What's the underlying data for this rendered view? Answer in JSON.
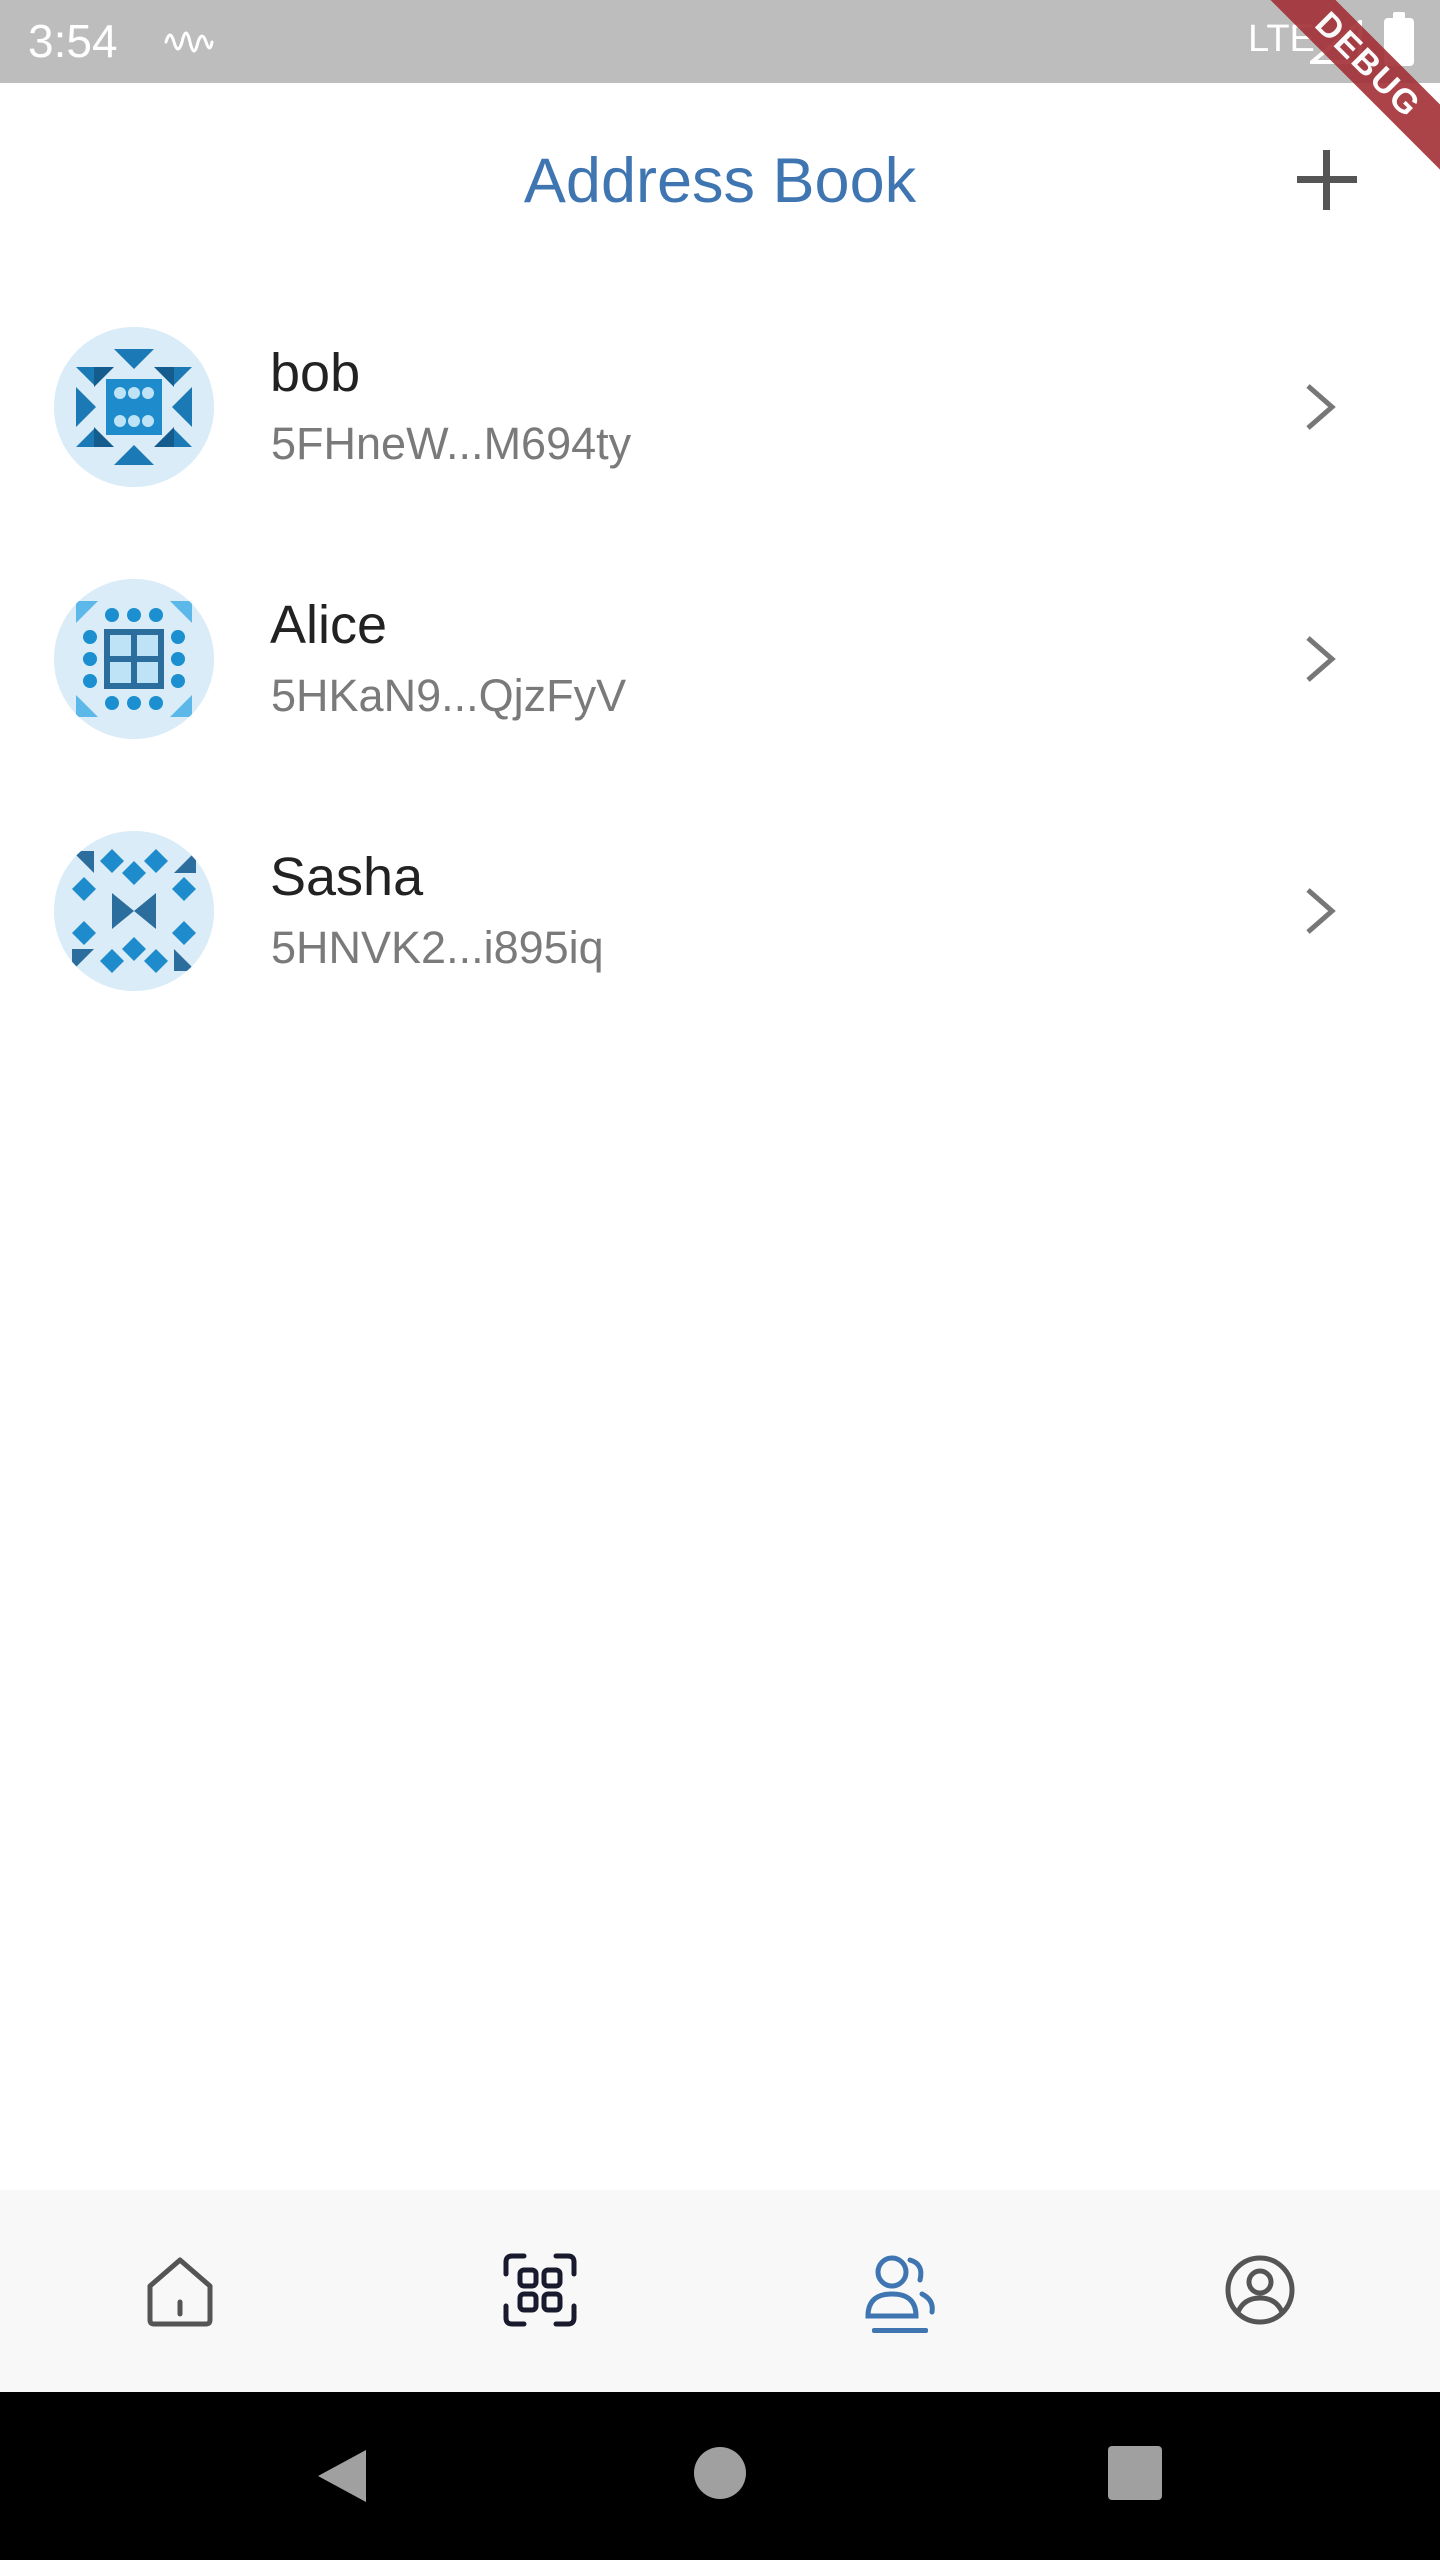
{
  "status_bar": {
    "time": "3:54",
    "network": "LTE",
    "notification_icon": "waveform-icon",
    "signal_icon": "signal-icon",
    "battery_icon": "battery-icon"
  },
  "debug_banner": "DEBUG",
  "header": {
    "title": "Address Book",
    "add_icon": "plus-icon"
  },
  "contacts": [
    {
      "name": "bob",
      "address": "5FHneW...M694ty",
      "avatar_icon": "identicon-avatar"
    },
    {
      "name": "Alice",
      "address": "5HKaN9...QjzFyV",
      "avatar_icon": "identicon-avatar"
    },
    {
      "name": "Sasha",
      "address": "5HNVK2...i895iq",
      "avatar_icon": "identicon-avatar"
    }
  ],
  "bottom_nav": {
    "items": [
      {
        "icon": "home-icon",
        "active": false
      },
      {
        "icon": "qr-scan-icon",
        "active": false
      },
      {
        "icon": "contacts-icon",
        "active": true
      },
      {
        "icon": "profile-icon",
        "active": false
      }
    ]
  },
  "system_nav": [
    "back-icon",
    "home-circle-icon",
    "recents-icon"
  ],
  "colors": {
    "accent": "#3f76b2",
    "status_bar": "#bdbdbd",
    "text_primary": "#222222",
    "text_secondary": "#7a7a7a",
    "debug_ribbon": "#a4343a"
  }
}
